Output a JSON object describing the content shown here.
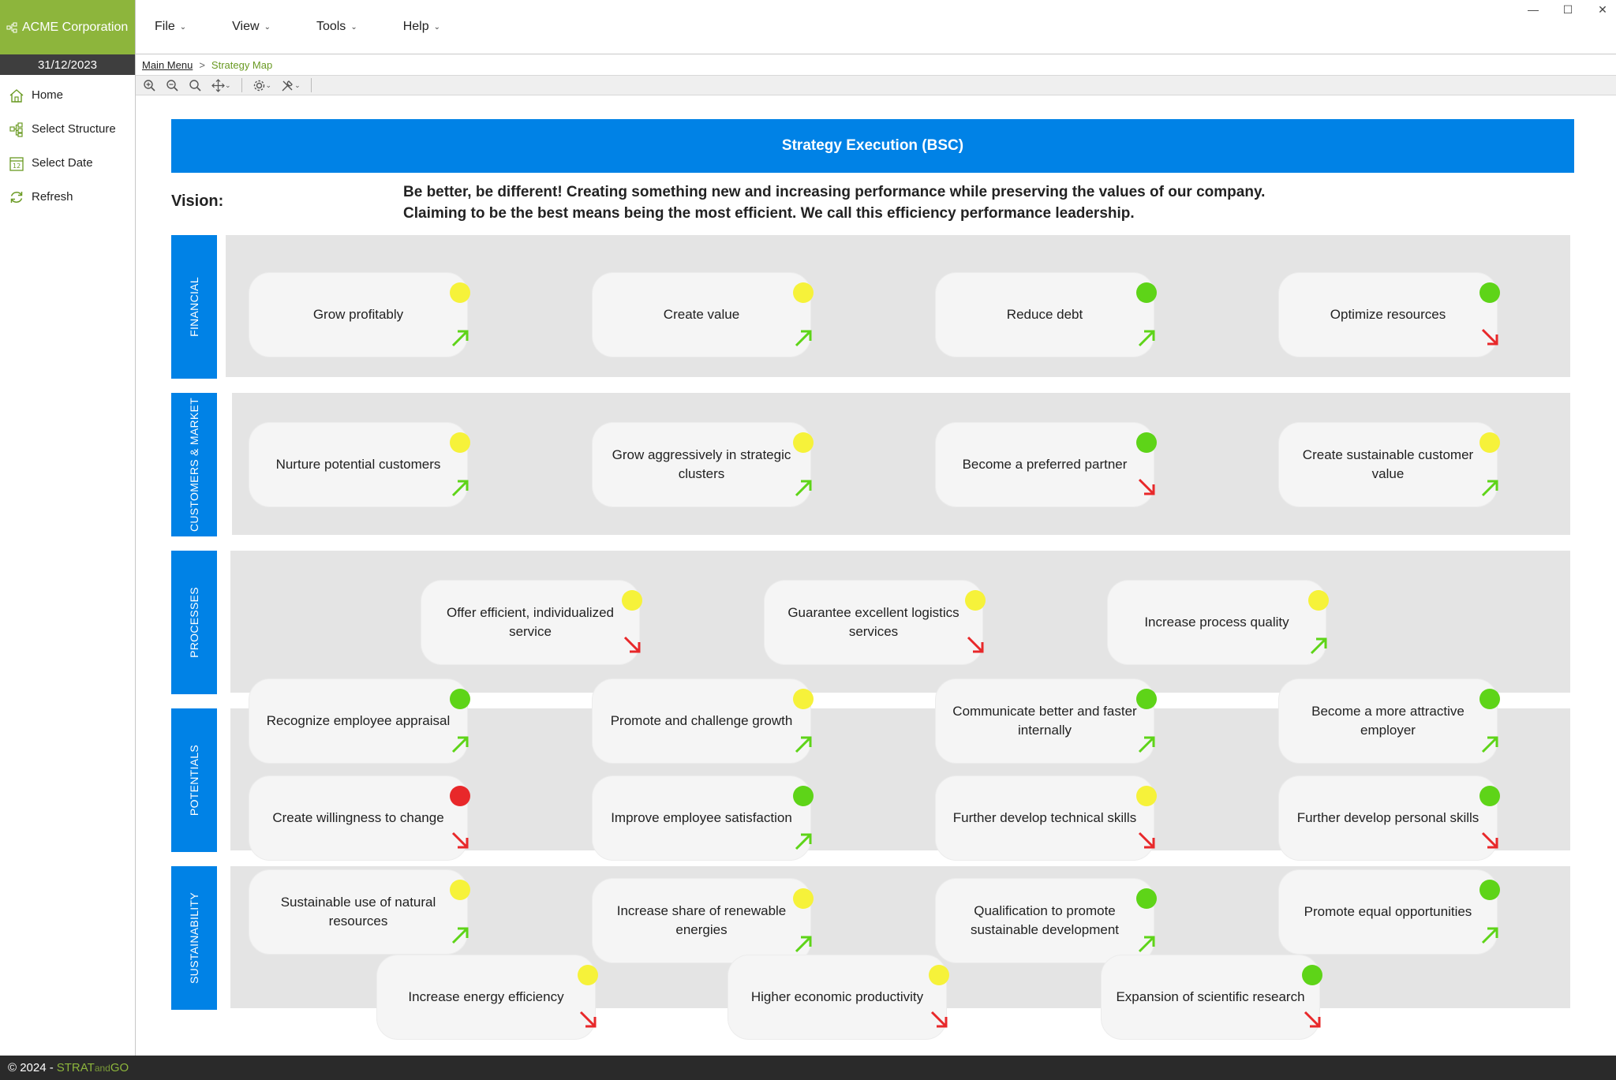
{
  "app": {
    "company": "ACME Corporation",
    "date": "31/12/2023"
  },
  "window": {
    "minimize": "—",
    "maximize": "☐",
    "close": "✕"
  },
  "menu": [
    {
      "label": "File"
    },
    {
      "label": "View"
    },
    {
      "label": "Tools"
    },
    {
      "label": "Help"
    }
  ],
  "sidebar": {
    "items": [
      {
        "label": "Home",
        "icon": "home-icon"
      },
      {
        "label": "Select Structure",
        "icon": "structure-icon"
      },
      {
        "label": "Select Date",
        "icon": "calendar-icon"
      },
      {
        "label": "Refresh",
        "icon": "refresh-icon"
      }
    ]
  },
  "breadcrumb": {
    "root": "Main Menu",
    "separator": ">",
    "current": "Strategy Map"
  },
  "toolbar": {
    "items": [
      {
        "icon": "zoom-in-icon"
      },
      {
        "icon": "zoom-out-icon"
      },
      {
        "icon": "zoom-fit-icon"
      },
      {
        "icon": "move-icon"
      },
      {
        "icon": "settings-icon"
      },
      {
        "icon": "tools-icon"
      }
    ]
  },
  "map": {
    "title": "Strategy Execution (BSC)",
    "vision_label": "Vision:",
    "vision_lines": [
      "Be better, be different! Creating something new and increasing performance while preserving the values of our company.",
      "Claiming to be the best means being the most efficient. We call this efficiency performance leadership."
    ],
    "perspectives": [
      {
        "label": "FINANCIAL"
      },
      {
        "label": "CUSTOMERS & MARKET"
      },
      {
        "label": "PROCESSES"
      },
      {
        "label": "POTENTIALS"
      },
      {
        "label": "SUSTAINABILITY"
      }
    ],
    "status_colors": {
      "yellow": "#f6f23a",
      "green": "#5ed418",
      "red": "#e8282a"
    },
    "trend_colors": {
      "up": "#5ed418",
      "down": "#e8282a"
    },
    "objectives": [
      {
        "label": "Grow profitably",
        "status": "yellow",
        "trend": "up"
      },
      {
        "label": "Create value",
        "status": "yellow",
        "trend": "up"
      },
      {
        "label": "Reduce debt",
        "status": "green",
        "trend": "up"
      },
      {
        "label": "Optimize resources",
        "status": "green",
        "trend": "down"
      },
      {
        "label": "Nurture potential customers",
        "status": "yellow",
        "trend": "up"
      },
      {
        "label": "Grow aggressively in strategic clusters",
        "status": "yellow",
        "trend": "up"
      },
      {
        "label": "Become a preferred partner",
        "status": "green",
        "trend": "down"
      },
      {
        "label": "Create sustainable customer value",
        "status": "yellow",
        "trend": "up"
      },
      {
        "label": "Offer efficient, individualized service",
        "status": "yellow",
        "trend": "down"
      },
      {
        "label": "Guarantee excellent logistics services",
        "status": "yellow",
        "trend": "down"
      },
      {
        "label": "Increase process quality",
        "status": "yellow",
        "trend": "up"
      },
      {
        "label": "Recognize employee appraisal",
        "status": "green",
        "trend": "up"
      },
      {
        "label": "Promote and challenge growth",
        "status": "yellow",
        "trend": "up"
      },
      {
        "label": "Communicate better and faster internally",
        "status": "green",
        "trend": "up"
      },
      {
        "label": "Become a more attractive employer",
        "status": "green",
        "trend": "up"
      },
      {
        "label": "Create willingness to change",
        "status": "red",
        "trend": "down"
      },
      {
        "label": "Improve employee satisfaction",
        "status": "green",
        "trend": "up"
      },
      {
        "label": "Further develop technical skills",
        "status": "yellow",
        "trend": "down"
      },
      {
        "label": "Further develop personal skills",
        "status": "green",
        "trend": "down"
      },
      {
        "label": "Sustainable use of natural resources",
        "status": "yellow",
        "trend": "up"
      },
      {
        "label": "Increase share of renewable energies",
        "status": "yellow",
        "trend": "up"
      },
      {
        "label": "Qualification to promote sustainable development",
        "status": "green",
        "trend": "up"
      },
      {
        "label": "Promote equal opportunities",
        "status": "green",
        "trend": "up"
      },
      {
        "label": "Increase energy efficiency",
        "status": "yellow",
        "trend": "down"
      },
      {
        "label": "Higher economic productivity",
        "status": "yellow",
        "trend": "down"
      },
      {
        "label": "Expansion of scientific research",
        "status": "green",
        "trend": "down"
      }
    ]
  },
  "footer": {
    "copyright": "© 2024 - ",
    "brand_a": "STRAT",
    "brand_b": "and",
    "brand_c": "GO"
  }
}
